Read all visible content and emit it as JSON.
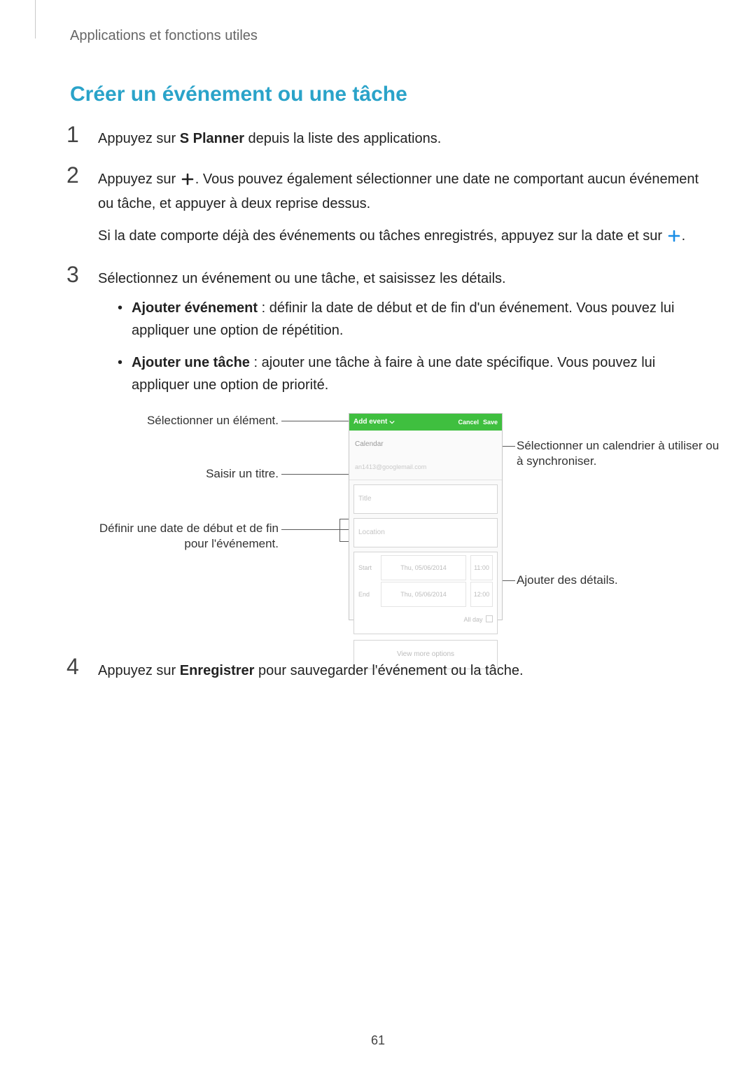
{
  "breadcrumb": "Applications et fonctions utiles",
  "section_title": "Créer un événement ou une tâche",
  "steps": {
    "s1": {
      "pre": "Appuyez sur ",
      "bold": "S Planner",
      "post": " depuis la liste des applications."
    },
    "s2": {
      "part_a_pre": "Appuyez sur ",
      "part_a_post": ". Vous pouvez également sélectionner une date ne comportant aucun événement ou tâche, et appuyer à deux reprise dessus.",
      "part_b_pre": "Si la date comporte déjà des événements ou tâches enregistrés, appuyez sur la date et sur ",
      "part_b_post": "."
    },
    "s3": {
      "intro": "Sélectionnez un événement ou une tâche, et saisissez les détails.",
      "bullet1_bold": "Ajouter événement",
      "bullet1_rest": " : définir la date de début et de fin d'un événement. Vous pouvez lui appliquer une option de répétition.",
      "bullet2_bold": "Ajouter une tâche",
      "bullet2_rest": " : ajouter une tâche à faire à une date spécifique. Vous pouvez lui appliquer une option de priorité."
    },
    "s4": {
      "pre": "Appuyez sur ",
      "bold": "Enregistrer",
      "post": " pour sauvegarder l'événement ou la tâche."
    }
  },
  "diagram": {
    "labels": {
      "select_element": "Sélectionner un élément.",
      "enter_title": "Saisir un titre.",
      "set_dates": "Définir une date de début et de fin pour l'événement.",
      "select_calendar": "Sélectionner un calendrier à utiliser ou à synchroniser.",
      "add_details": "Ajouter des détails."
    },
    "phone": {
      "add_event": "Add event",
      "cancel": "Cancel",
      "save": "Save",
      "calendar_label": "Calendar",
      "calendar_account": "an1413@googlemail.com",
      "title_placeholder": "Title",
      "location_placeholder": "Location",
      "start_label": "Start",
      "end_label": "End",
      "start_date": "Thu, 05/06/2014",
      "start_time": "11:00",
      "end_date": "Thu, 05/06/2014",
      "end_time": "12:00",
      "all_day": "All day",
      "view_more": "View more options"
    }
  },
  "page_number": "61"
}
